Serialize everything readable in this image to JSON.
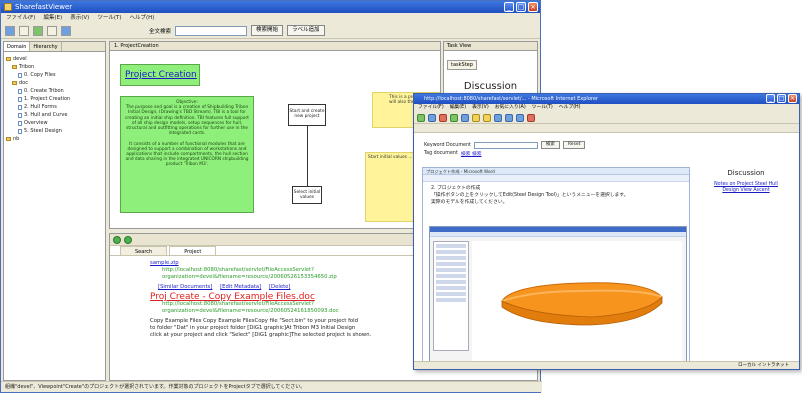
{
  "main": {
    "title": "SharefastViewer",
    "menu": [
      "ファイル(F)",
      "編集(E)",
      "表示(V)",
      "ツール(T)",
      "ヘルプ(H)"
    ],
    "toolbar": {
      "search_label": "全文検索",
      "btn_search": "検索開始",
      "btn_add": "ラベル追加"
    },
    "left_tabs": [
      "Domain",
      "Hierarchy"
    ],
    "tree": [
      {
        "label": "devel",
        "depth": 0,
        "kind": "folder"
      },
      {
        "label": "Tribon",
        "depth": 1,
        "kind": "folder"
      },
      {
        "label": "0. Copy Files",
        "depth": 2,
        "kind": "doc"
      },
      {
        "label": "doc",
        "depth": 1,
        "kind": "folder"
      },
      {
        "label": "0. Create Tribon",
        "depth": 2,
        "kind": "doc"
      },
      {
        "label": "1. Project Creation",
        "depth": 2,
        "kind": "doc"
      },
      {
        "label": "2. Hull Forms",
        "depth": 2,
        "kind": "doc"
      },
      {
        "label": "3. Hull and Curve",
        "depth": 2,
        "kind": "doc"
      },
      {
        "label": "Overview",
        "depth": 2,
        "kind": "doc"
      },
      {
        "label": "5. Steel Design",
        "depth": 2,
        "kind": "doc"
      },
      {
        "label": "nb",
        "depth": 0,
        "kind": "folder"
      }
    ],
    "center_tab": "1. ProjectCreation",
    "diagram": {
      "title": "Project Creation",
      "objective": "Objective:\nThe purpose and goal is a creation of Shipbuilding Tribon Initial Design, (Drawing's TBD Stream). TBI is a tool for creating an initial ship definition. TBI features full support of all ship design models, setup sequences for hull, structural and outfitting operations for further use in the integrated cards.\n\nIt consists of a number of functional modules that are designed to support a combination of workstations and applications that include compartments, the hull section and data sharing in the integrated UNICORN shipbuilding product 'Tribon M3'.",
      "step1": "Start and create new project",
      "step2": "Select initial values",
      "note1": "This is a project... You will also the note of ...",
      "note2": "Start initial values ..."
    },
    "right_panel": {
      "header": "Task View",
      "tab": "taskStep",
      "title": "Discussion"
    },
    "bottom": {
      "tabs": [
        "Search",
        "Project"
      ],
      "results": {
        "file1": "sample.zip",
        "url1": "http://localhost:8080/sharefast/servlet/FileAccessServlet?organization=devel&filename=resource/20060526153354650.zip",
        "actions": [
          "[Similar Documents]",
          "[Edit Metadata]",
          "[Delete]"
        ],
        "file2": "Proj Create - Copy Example Files.doc",
        "url2": "http://localhost:8080/sharefast/servlet/FileAccessServlet?organization=devel&filename=resource/20060524161850093.doc",
        "body1": "Copy Example Files Copy Example FilesCopy file \"Sect.bin\" to your project fold",
        "body2": "to folder \"Dat\" in your project folder [DiG1 graphic]At Tribon M3 Initial Design",
        "body3": "click at your project and click \"Select\" [DiG1 graphic]The selected project is shown."
      }
    },
    "status": "組織\"devel\"、Viewpoint\"Create\"のプロジェクトが選択されています。作業対象のプロジェクトをProjectタブで選択してください。"
  },
  "browser": {
    "title": "http://localhost:8080/sharefast/servlet/... - Microsoft Internet Explorer",
    "menu": [
      "ファイル(F)",
      "編集(E)",
      "表示(V)",
      "お気に入り(A)",
      "ツール(T)",
      "ヘルプ(H)"
    ],
    "search_label": "Keyword Document",
    "tag_label": "Tag document",
    "search_btn": "検索",
    "reset_btn": "Reset",
    "search_link": "検索 検索",
    "word_bar": "プロジェクト作成 - Microsoft Word",
    "word_text_1": "2. プロジェクトの作成",
    "word_text_2": "「操作ボタンの上をクリックしてEdit(Steel Design Tool)」というメニューを選択します。",
    "word_text_3": "実際のモデルを作成してください。",
    "discussion_title": "Discussion",
    "disc_link_1": "Notes on Project Steel Hull",
    "disc_link_2": "Design View Ascent",
    "status": "ローカル イントラネット"
  },
  "colors": {
    "diagram_green": "#8ef07a",
    "note_yellow": "#fff49a",
    "hull_orange": "#f7941d",
    "link_blue": "#1a1ac8",
    "title_red": "#e02020"
  }
}
